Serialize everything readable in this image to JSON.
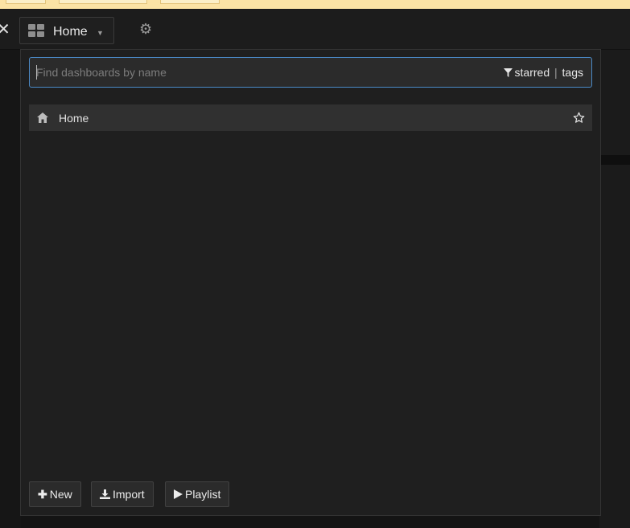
{
  "navbar": {
    "dashboard_title": "Home",
    "icons": {
      "close": "close-icon",
      "dashboards": "grid-icon",
      "caret": "chevron-down-icon",
      "settings": "gear-icon"
    }
  },
  "search": {
    "placeholder": "Find dashboards by name",
    "value": "",
    "filter_starred": "starred",
    "filter_separator": "|",
    "filter_tags": "tags"
  },
  "results": [
    {
      "label": "Home",
      "icon": "home-icon",
      "starred": false
    }
  ],
  "footer": {
    "new_label": "New",
    "import_label": "Import",
    "playlist_label": "Playlist"
  },
  "colors": {
    "accent_focus": "#4b8ac7",
    "panel_bg": "#1f1f1f",
    "row_bg": "#303030",
    "top_strip": "#fbe3a5"
  }
}
